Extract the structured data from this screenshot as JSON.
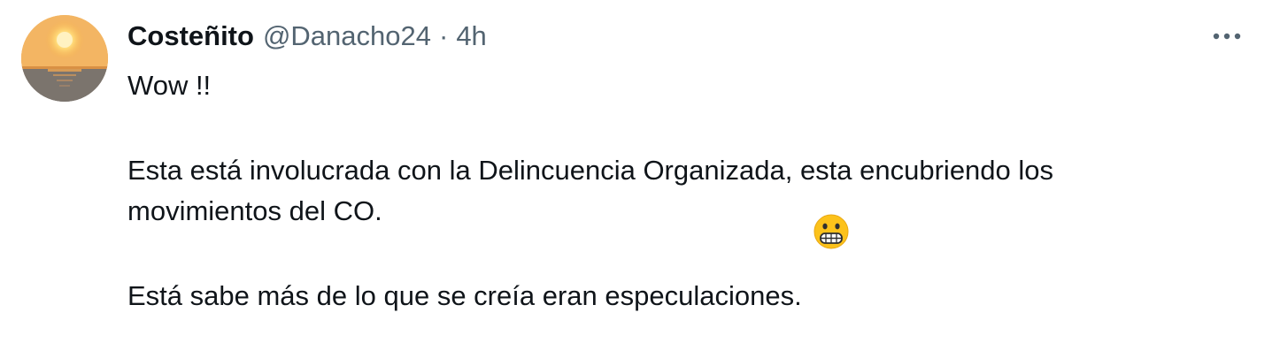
{
  "tweet": {
    "display_name": "Costeñito",
    "handle": "@Danacho24",
    "separator": "·",
    "time": "4h",
    "more_icon": "more-horizontal-icon",
    "avatar_icon": "sunset-avatar",
    "text": {
      "line1": "Wow !!",
      "line2": "Esta está involucrada con la Delincuencia Organizada, esta encubriendo los",
      "line3": "movimientos del CO.",
      "line4": "Está sabe más de lo que se creía eran especulaciones."
    },
    "emoji": "grimacing-face-emoji"
  }
}
